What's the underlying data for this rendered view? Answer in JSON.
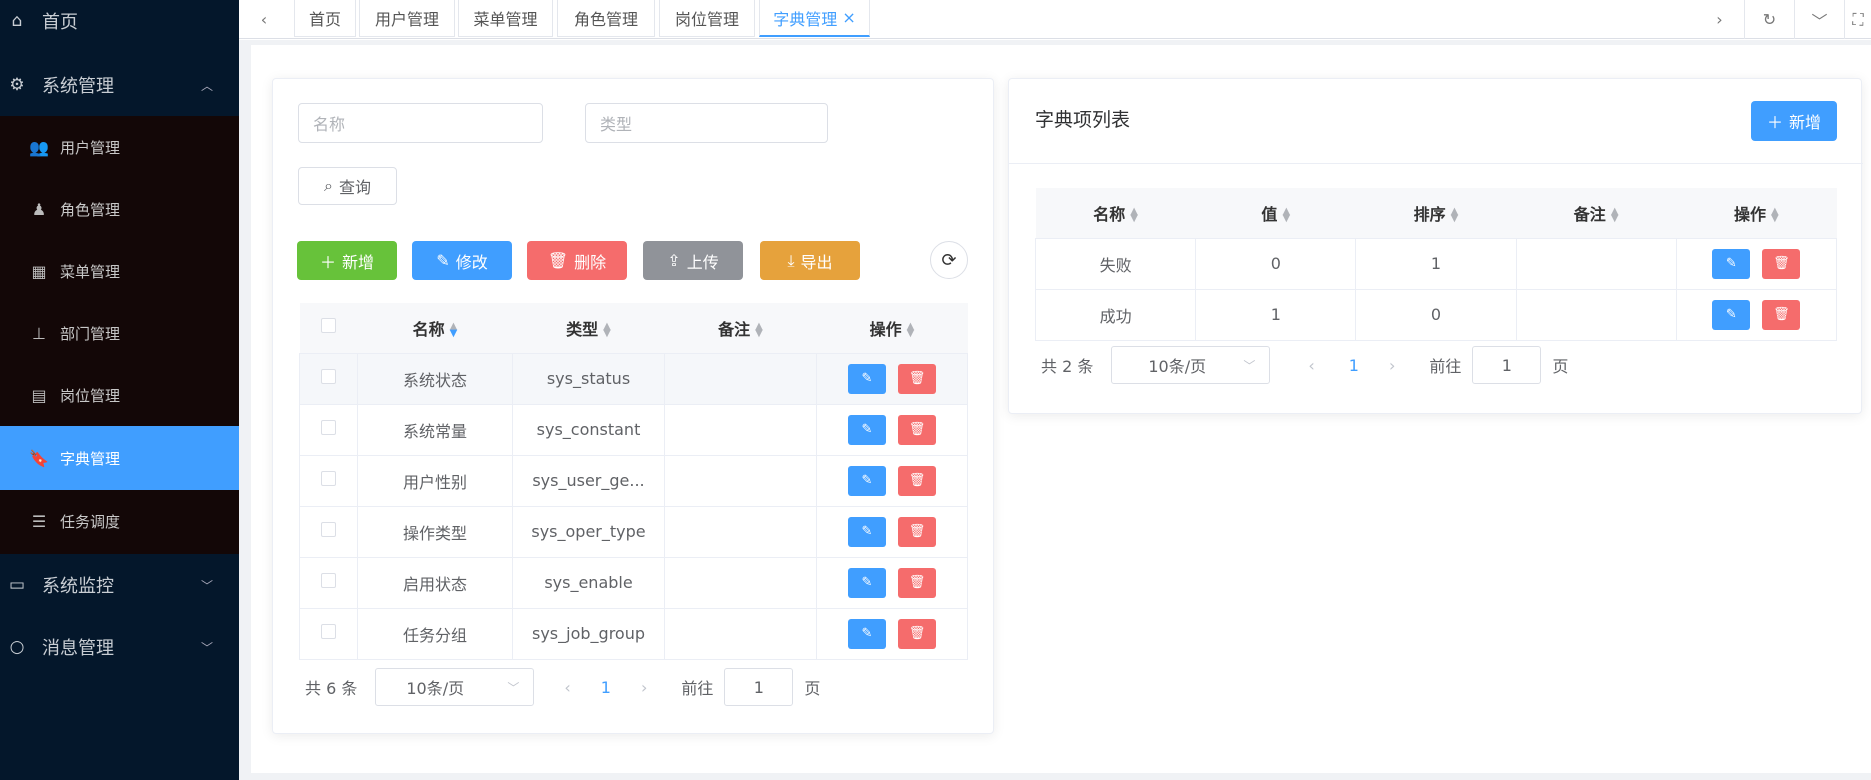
{
  "sidebar": {
    "home": "首页",
    "system": "系统管理",
    "sub": [
      "用户管理",
      "角色管理",
      "菜单管理",
      "部门管理",
      "岗位管理",
      "字典管理",
      "任务调度"
    ],
    "monitor": "系统监控",
    "message": "消息管理"
  },
  "tabs": [
    "首页",
    "用户管理",
    "菜单管理",
    "角色管理",
    "岗位管理",
    "字典管理"
  ],
  "tab_close": "×",
  "search": {
    "name_placeholder": "名称",
    "type_placeholder": "类型",
    "query": "查询"
  },
  "toolbar": {
    "add": "新增",
    "edit": "修改",
    "delete": "删除",
    "upload": "上传",
    "export": "导出"
  },
  "dict_table": {
    "headers": [
      "名称",
      "类型",
      "备注",
      "操作"
    ],
    "rows": [
      {
        "name": "系统状态",
        "type": "sys_status",
        "note": ""
      },
      {
        "name": "系统常量",
        "type": "sys_constant",
        "note": ""
      },
      {
        "name": "用户性别",
        "type": "sys_user_ge...",
        "note": ""
      },
      {
        "name": "操作类型",
        "type": "sys_oper_type",
        "note": ""
      },
      {
        "name": "启用状态",
        "type": "sys_enable",
        "note": ""
      },
      {
        "name": "任务分组",
        "type": "sys_job_group",
        "note": ""
      }
    ],
    "pagination": {
      "total": "共 6 条",
      "page_size": "10条/页",
      "page": "1",
      "goto": "前往",
      "goto_value": "1",
      "page_suffix": "页"
    }
  },
  "item_panel": {
    "title": "字典项列表",
    "add": "新增",
    "headers": [
      "名称",
      "值",
      "排序",
      "备注",
      "操作"
    ],
    "rows": [
      {
        "name": "失败",
        "value": "0",
        "sort": "1",
        "note": ""
      },
      {
        "name": "成功",
        "value": "1",
        "sort": "0",
        "note": ""
      }
    ],
    "pagination": {
      "total": "共 2 条",
      "page_size": "10条/页",
      "page": "1",
      "goto": "前往",
      "goto_value": "1",
      "page_suffix": "页"
    }
  },
  "colors": {
    "primary": "#409eff",
    "success": "#67c23a",
    "danger": "#f56c6c",
    "info": "#909399",
    "warning": "#e6a23c"
  }
}
